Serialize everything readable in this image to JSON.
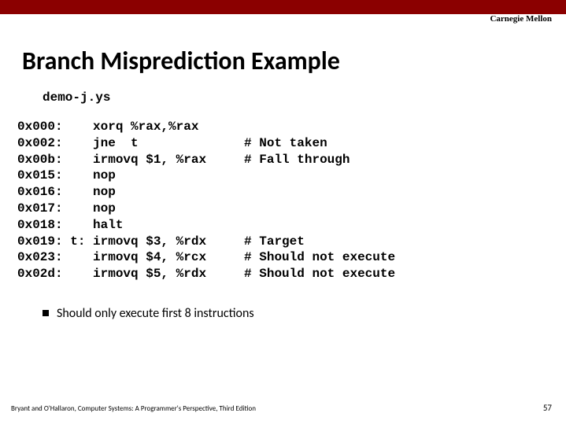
{
  "brand": "Carnegie Mellon",
  "title": "Branch Misprediction Example",
  "filename": "demo-j.ys",
  "code": {
    "lines": [
      {
        "addr": "0x000:",
        "lbl": "",
        "instr": "xorq %rax,%rax",
        "comment": ""
      },
      {
        "addr": "0x002:",
        "lbl": "",
        "instr": "jne  t",
        "comment": "# Not taken"
      },
      {
        "addr": "0x00b:",
        "lbl": "",
        "instr": "irmovq $1, %rax",
        "comment": "# Fall through"
      },
      {
        "addr": "0x015:",
        "lbl": "",
        "instr": "nop",
        "comment": ""
      },
      {
        "addr": "0x016:",
        "lbl": "",
        "instr": "nop",
        "comment": ""
      },
      {
        "addr": "0x017:",
        "lbl": "",
        "instr": "nop",
        "comment": ""
      },
      {
        "addr": "0x018:",
        "lbl": "",
        "instr": "halt",
        "comment": ""
      },
      {
        "addr": "0x019:",
        "lbl": "t:",
        "instr": "irmovq $3, %rdx",
        "comment": "# Target"
      },
      {
        "addr": "0x023:",
        "lbl": "",
        "instr": "irmovq $4, %rcx",
        "comment": "# Should not execute"
      },
      {
        "addr": "0x02d:",
        "lbl": "",
        "instr": "irmovq $5, %rdx",
        "comment": "# Should not execute"
      }
    ]
  },
  "note": "Should only execute first 8 instructions",
  "footer_left": "Bryant and O'Hallaron, Computer Systems: A Programmer's Perspective, Third Edition",
  "page_num": "57"
}
